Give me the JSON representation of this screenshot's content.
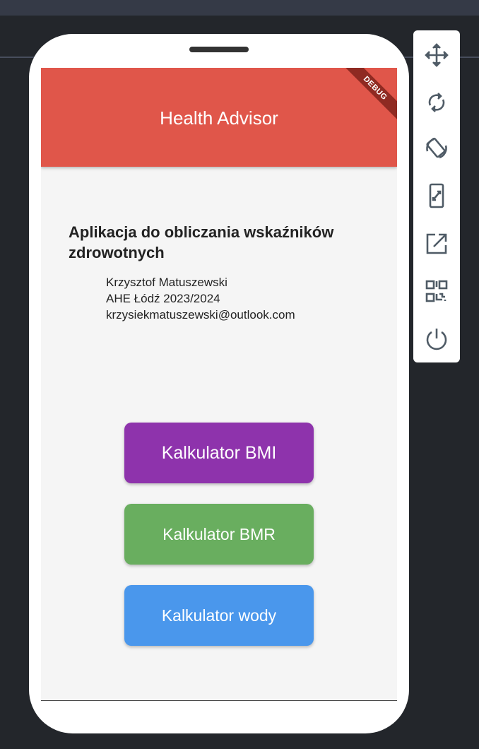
{
  "app": {
    "title": "Health Advisor",
    "debug_banner": "DEBUG"
  },
  "main": {
    "heading": "Aplikacja do obliczania wskaźników zdrowotnych",
    "author": "Krzysztof Matuszewski",
    "school": "AHE Łódź 2023/2024",
    "email": "krzysiekmatuszewski@outlook.com"
  },
  "buttons": [
    {
      "label": "Kalkulator BMI",
      "color": "#8e33ac"
    },
    {
      "label": "Kalkulator BMR",
      "color": "#69ae5f"
    },
    {
      "label": "Kalkulator wody",
      "color": "#4a97ec"
    }
  ],
  "toolbar": [
    "move-icon",
    "rotate-icon",
    "rotate-device-icon",
    "resize-icon",
    "open-external-icon",
    "qr-code-icon",
    "power-icon"
  ]
}
